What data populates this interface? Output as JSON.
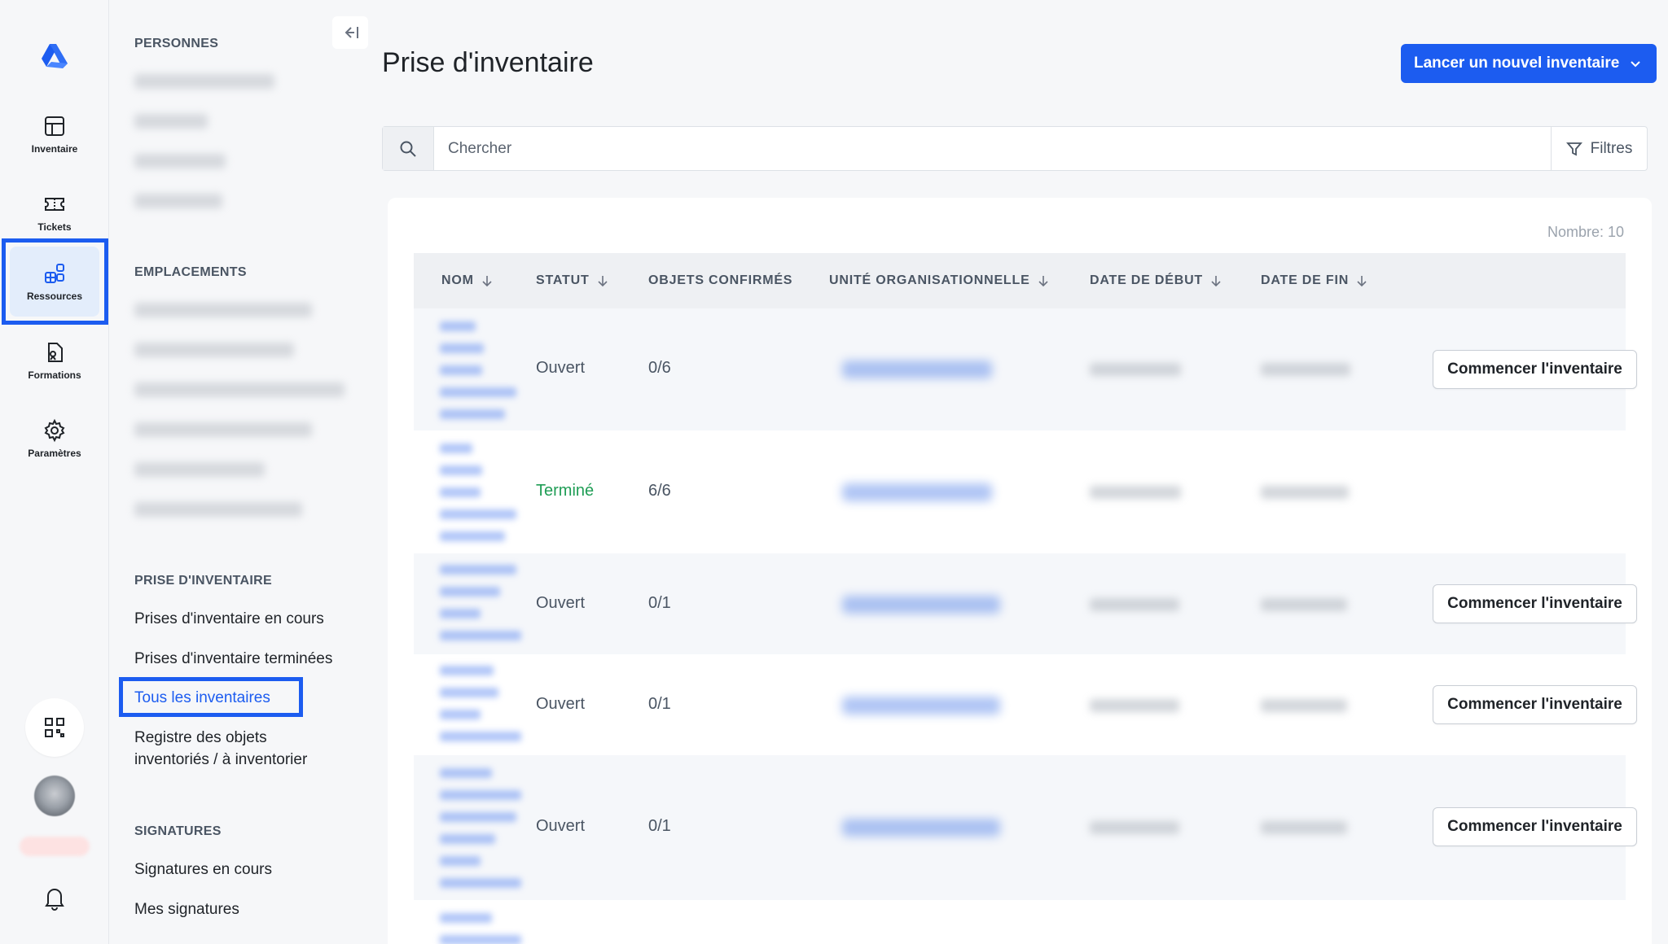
{
  "rail": {
    "items": [
      {
        "label": "Inventaire",
        "icon": "inventory-grid-icon"
      },
      {
        "label": "Tickets",
        "icon": "ticket-icon"
      },
      {
        "label": "Ressources",
        "icon": "resources-icon",
        "active": true
      },
      {
        "label": "Formations",
        "icon": "formation-doc-icon"
      },
      {
        "label": "Paramètres",
        "icon": "gear-icon"
      }
    ]
  },
  "subnav": {
    "sections": {
      "personnes": "PERSONNES",
      "emplacements": "EMPLACEMENTS",
      "prise": "PRISE D'INVENTAIRE",
      "signatures": "SIGNATURES"
    },
    "prise_links": [
      "Prises d'inventaire en cours",
      "Prises d'inventaire terminées",
      "Tous les inventaires",
      "Registre des objets\ninventoriés / à inventorier"
    ],
    "signature_links": [
      "Signatures en cours",
      "Mes signatures"
    ]
  },
  "header": {
    "title": "Prise d'inventaire",
    "primary_button": "Lancer un nouvel inventaire"
  },
  "search": {
    "placeholder": "Chercher",
    "filters_label": "Filtres"
  },
  "table": {
    "count_label": "Nombre: 10",
    "columns": [
      "NOM",
      "STATUT",
      "OBJETS CONFIRMÉS",
      "UNITÉ ORGANISATIONNELLE",
      "DATE DE DÉBUT",
      "DATE DE FIN"
    ],
    "rows": [
      {
        "status": "Ouvert",
        "confirmed": "0/6",
        "action": "Commencer l'inventaire"
      },
      {
        "status": "Terminé",
        "confirmed": "6/6",
        "action": ""
      },
      {
        "status": "Ouvert",
        "confirmed": "0/1",
        "action": "Commencer l'inventaire"
      },
      {
        "status": "Ouvert",
        "confirmed": "0/1",
        "action": "Commencer l'inventaire"
      },
      {
        "status": "Ouvert",
        "confirmed": "0/1",
        "action": "Commencer l'inventaire"
      }
    ]
  },
  "colors": {
    "accent": "#1c5cf0",
    "success": "#1f9d55"
  }
}
